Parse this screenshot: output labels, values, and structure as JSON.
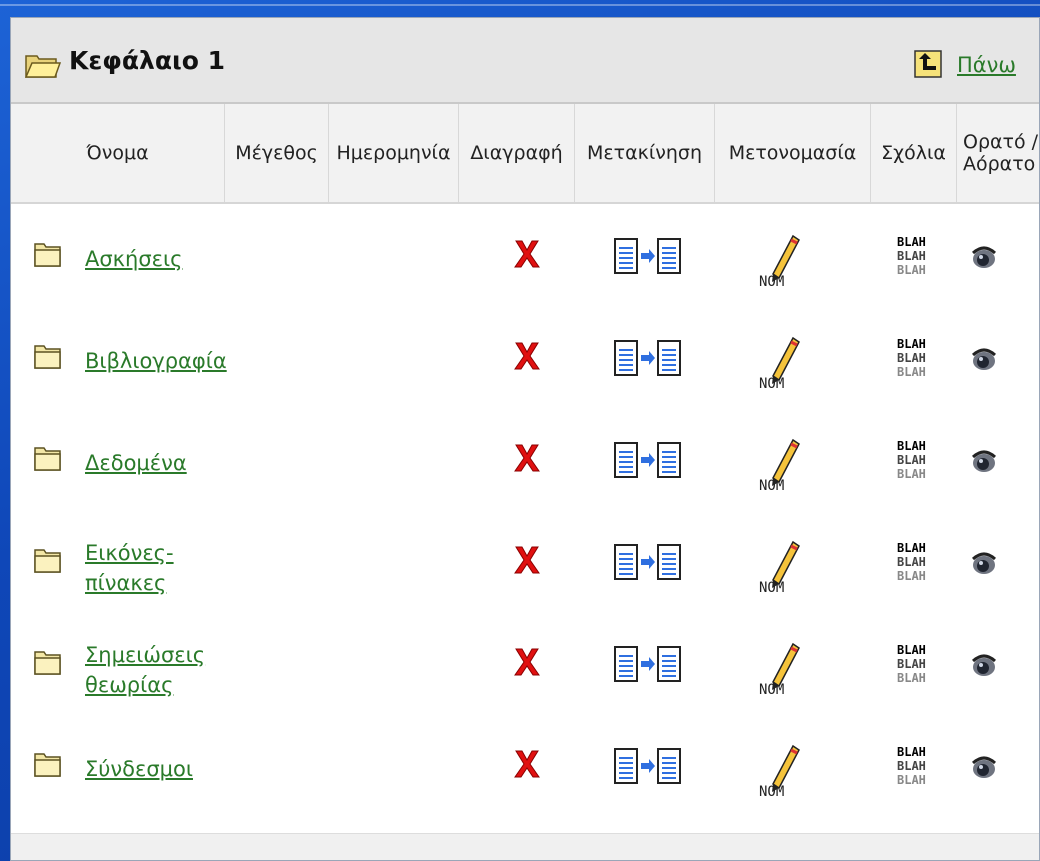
{
  "header": {
    "title": "Κεφάλαιο 1",
    "up_link": "Πάνω"
  },
  "columns": {
    "name": "Όνομα",
    "size": "Μέγεθος",
    "date": "Ημερομηνία",
    "delete": "Διαγραφή",
    "move": "Μετακίνηση",
    "rename": "Μετονομασία",
    "comments": "Σχόλια",
    "visibility_line1": "Ορατό /",
    "visibility_line2": "Αόρατο"
  },
  "rows": [
    {
      "name": "Ασκήσεις"
    },
    {
      "name": "Βιβλιογραφία"
    },
    {
      "name": "Δεδομένα"
    },
    {
      "name": "Εικόνες-\nπίνακες"
    },
    {
      "name": "Σημειώσεις\nθεωρίας"
    },
    {
      "name": "Σύνδεσμοι"
    }
  ],
  "icons": {
    "folder": "folder-icon",
    "delete": "delete-x-icon",
    "move": "move-document-icon",
    "rename": "rename-pencil-icon",
    "comments": "comments-blah-icon",
    "visibility": "visibility-eye-icon",
    "up": "folder-up-icon"
  },
  "colors": {
    "link": "#2a7a2a",
    "delete": "#e01010",
    "background": "#1652c4"
  },
  "rename_icon_text": "NOM",
  "comment_icon_text": "BLAH"
}
